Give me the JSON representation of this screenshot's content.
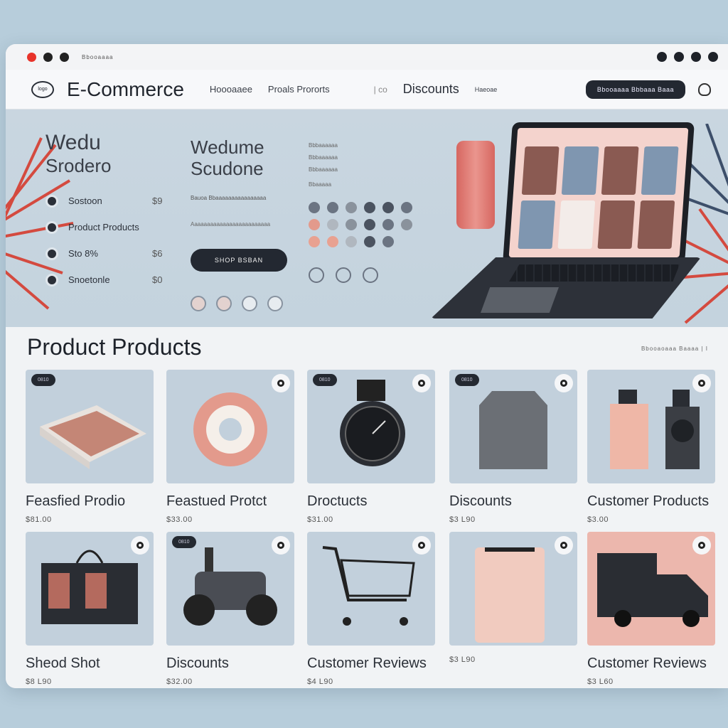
{
  "titlebar": {
    "title": "Bbooaaaa"
  },
  "header": {
    "brand": "E-Commerce",
    "logo_text": "logo",
    "nav": [
      "Hoooaaee",
      "Proals Prororts",
      "Discounts",
      "Haeoae"
    ],
    "nav_sep": "| co",
    "cta_label": "Bbooaaaa Bbbaaa Baaa",
    "icons": [
      "user-icon"
    ]
  },
  "hero": {
    "col1": {
      "title_line1": "Wedu",
      "title_line2": "Srodero",
      "items": [
        {
          "label": "Sostoon",
          "value": "$9"
        },
        {
          "label": "Product Products",
          "value": ""
        },
        {
          "label": "Sto 8%",
          "value": "$6"
        },
        {
          "label": "Snoetonle",
          "value": "$0"
        }
      ]
    },
    "col2": {
      "title_line1": "Wedume",
      "title_line2": "Scudone",
      "sub1": "Bauoa Bbaaaaaaaaaaaaaaaa",
      "sub2": "Aaaaaaaaaaaaaaaaaaaaaaaaa",
      "shop_label": "SHOP BSBAN"
    },
    "col3": {
      "lines": [
        "Bbbaaaaaa",
        "Bbbaaaaaa",
        "Bbbaaaaaa",
        "Bbaaaaa"
      ]
    },
    "accent_colors": [
      "#d9534a",
      "#f4d3cd",
      "#232831"
    ]
  },
  "products": {
    "title": "Product Products",
    "meta": "Bbooaoaaa Baaaa | I",
    "badge": "0810",
    "cards": [
      {
        "name": "Feasfied Prodio",
        "price": "$81.00"
      },
      {
        "name": "Feastued Protct",
        "price": "$33.00"
      },
      {
        "name": "Droctucts",
        "price": "$31.00"
      },
      {
        "name": "Discounts",
        "price": "$3 L90"
      },
      {
        "name": "Customer Products",
        "price": "$3.00"
      },
      {
        "name": "Sheod Shot",
        "price": "$8 L90"
      },
      {
        "name": "Discounts",
        "price": "$32.00"
      },
      {
        "name": "Customer Reviews",
        "price": "$4 L90"
      },
      {
        "name": "",
        "price": "$3 L90"
      },
      {
        "name": "Customer Reviews",
        "price": "$3 L60"
      }
    ]
  }
}
